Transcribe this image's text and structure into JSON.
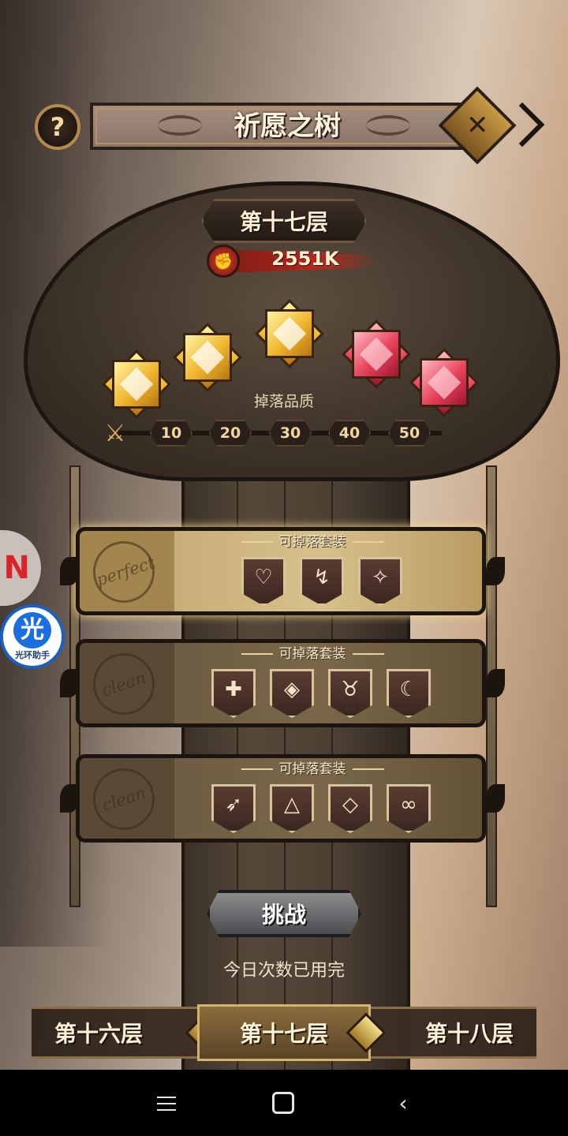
{
  "header": {
    "title": "祈愿之树",
    "help_label": "?",
    "close_label": "✕"
  },
  "floor": {
    "current_name": "第十七层",
    "power_value": "2551K"
  },
  "drop_quality": {
    "label": "掉落品质",
    "gems": [
      {
        "color": "gold"
      },
      {
        "color": "gold"
      },
      {
        "color": "gold"
      },
      {
        "color": "red"
      },
      {
        "color": "red"
      }
    ],
    "ticks": [
      "10",
      "20",
      "30",
      "40",
      "50"
    ]
  },
  "sets": [
    {
      "caption": "可掉落套装",
      "stamp": "perfect",
      "state": "active",
      "icons": [
        {
          "glyph": "♡",
          "name": "heart-set-icon"
        },
        {
          "glyph": "↯",
          "name": "dagger-set-icon"
        },
        {
          "glyph": "✧",
          "name": "star-set-icon"
        }
      ]
    },
    {
      "caption": "可掉落套装",
      "stamp": "clean",
      "state": "dim",
      "icons": [
        {
          "glyph": "✚",
          "name": "shield-cross-set-icon"
        },
        {
          "glyph": "◈",
          "name": "diamond-set-icon"
        },
        {
          "glyph": "♉",
          "name": "horns-set-icon"
        },
        {
          "glyph": "☾",
          "name": "moon-set-icon"
        }
      ]
    },
    {
      "caption": "可掉落套装",
      "stamp": "clean",
      "state": "dim",
      "icons": [
        {
          "glyph": "➶",
          "name": "bow-set-icon"
        },
        {
          "glyph": "△",
          "name": "triangle-set-icon"
        },
        {
          "glyph": "◇",
          "name": "rhombus-set-icon"
        },
        {
          "glyph": "∞",
          "name": "swirl-set-icon"
        }
      ]
    }
  ],
  "actions": {
    "challenge_label": "挑战",
    "limit_text": "今日次数已用完"
  },
  "floor_nav": {
    "prev": "第十六层",
    "current": "第十七层",
    "next": "第十八层"
  },
  "overlay": {
    "assistant_glyph": "光",
    "assistant_label": "光环助手",
    "red_glyph": "N"
  },
  "system_bar": {
    "menu": "menu-icon",
    "home": "home-icon",
    "back": "back-icon"
  },
  "colors": {
    "gold_gem": "#f0b52c",
    "red_gem": "#e8405a",
    "power_red": "#b3291e",
    "accent_gold": "#d6b36c"
  }
}
